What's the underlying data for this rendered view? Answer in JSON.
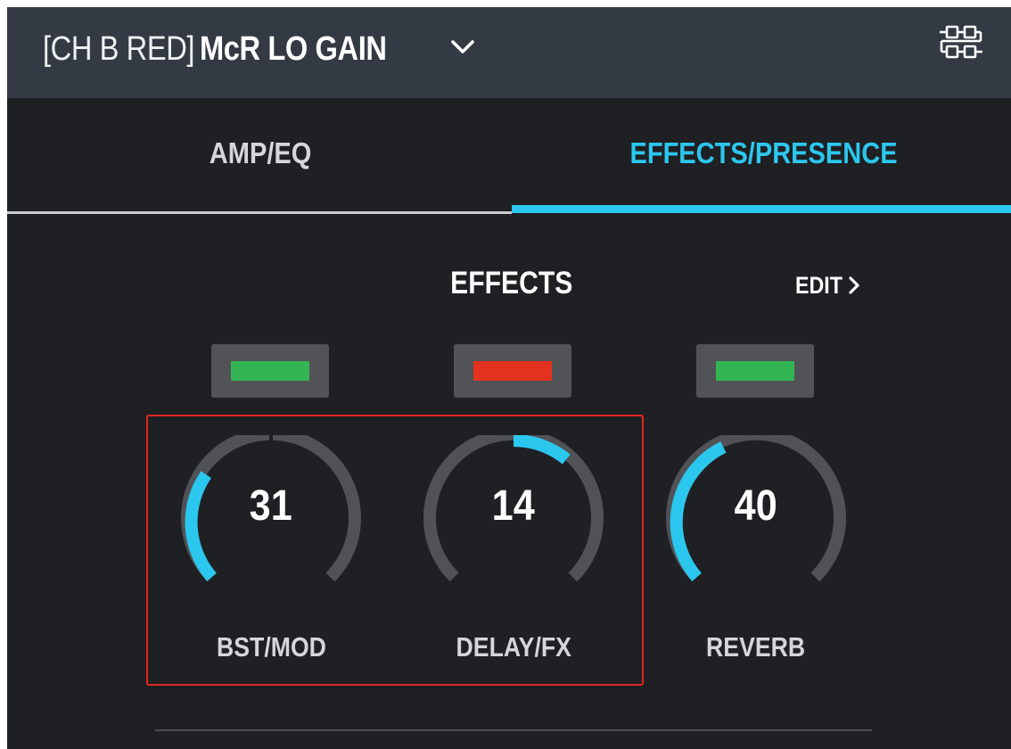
{
  "header": {
    "channel": "[CH B RED]",
    "preset_name": "McR LO GAIN"
  },
  "tabs": [
    {
      "label": "AMP/EQ",
      "active": false
    },
    {
      "label": "EFFECTS/PRESENCE",
      "active": true
    }
  ],
  "effects": {
    "title": "EFFECTS",
    "edit_label": "EDIT",
    "toggles": [
      {
        "state": "on",
        "color": "#34b553"
      },
      {
        "state": "off",
        "color": "#e5311f"
      },
      {
        "state": "on",
        "color": "#34b553"
      }
    ],
    "knobs": [
      {
        "label": "BST/MOD",
        "value": "31"
      },
      {
        "label": "DELAY/FX",
        "value": "14"
      },
      {
        "label": "REVERB",
        "value": "40"
      }
    ]
  },
  "colors": {
    "accent": "#2cc7ee",
    "header_bg": "#343a43",
    "panel_bg": "#1f2023",
    "knob_track": "#505255",
    "highlight": "#e32422"
  },
  "icons": {
    "preset_dropdown": "chevron-down-icon",
    "signal_chain": "signal-chain-icon",
    "edit": "chevron-right-icon"
  }
}
